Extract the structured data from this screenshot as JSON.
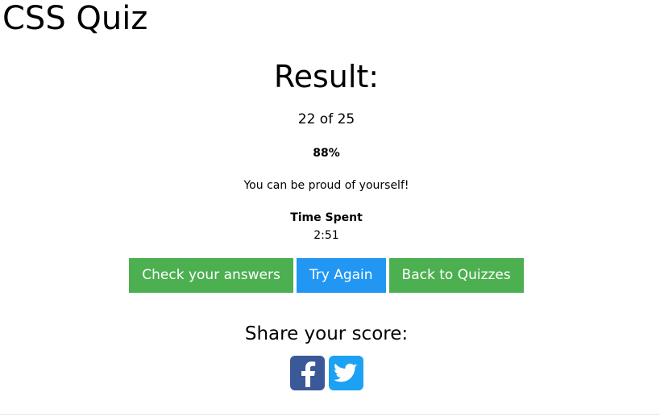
{
  "header": {
    "title": "CSS Quiz"
  },
  "result": {
    "heading": "Result:",
    "score_text": "22 of 25",
    "percent_text": "88%",
    "message": "You can be proud of yourself!",
    "time_label": "Time Spent",
    "time_value": "2:51"
  },
  "actions": {
    "check_answers_label": "Check your answers",
    "try_again_label": "Try Again",
    "back_label": "Back to Quizzes"
  },
  "share": {
    "heading": "Share your score:",
    "icons": [
      "facebook-icon",
      "twitter-icon"
    ]
  },
  "colors": {
    "green_button": "#4caf50",
    "blue_button": "#2196f3",
    "facebook": "#3b5998",
    "twitter": "#1da1f2"
  }
}
